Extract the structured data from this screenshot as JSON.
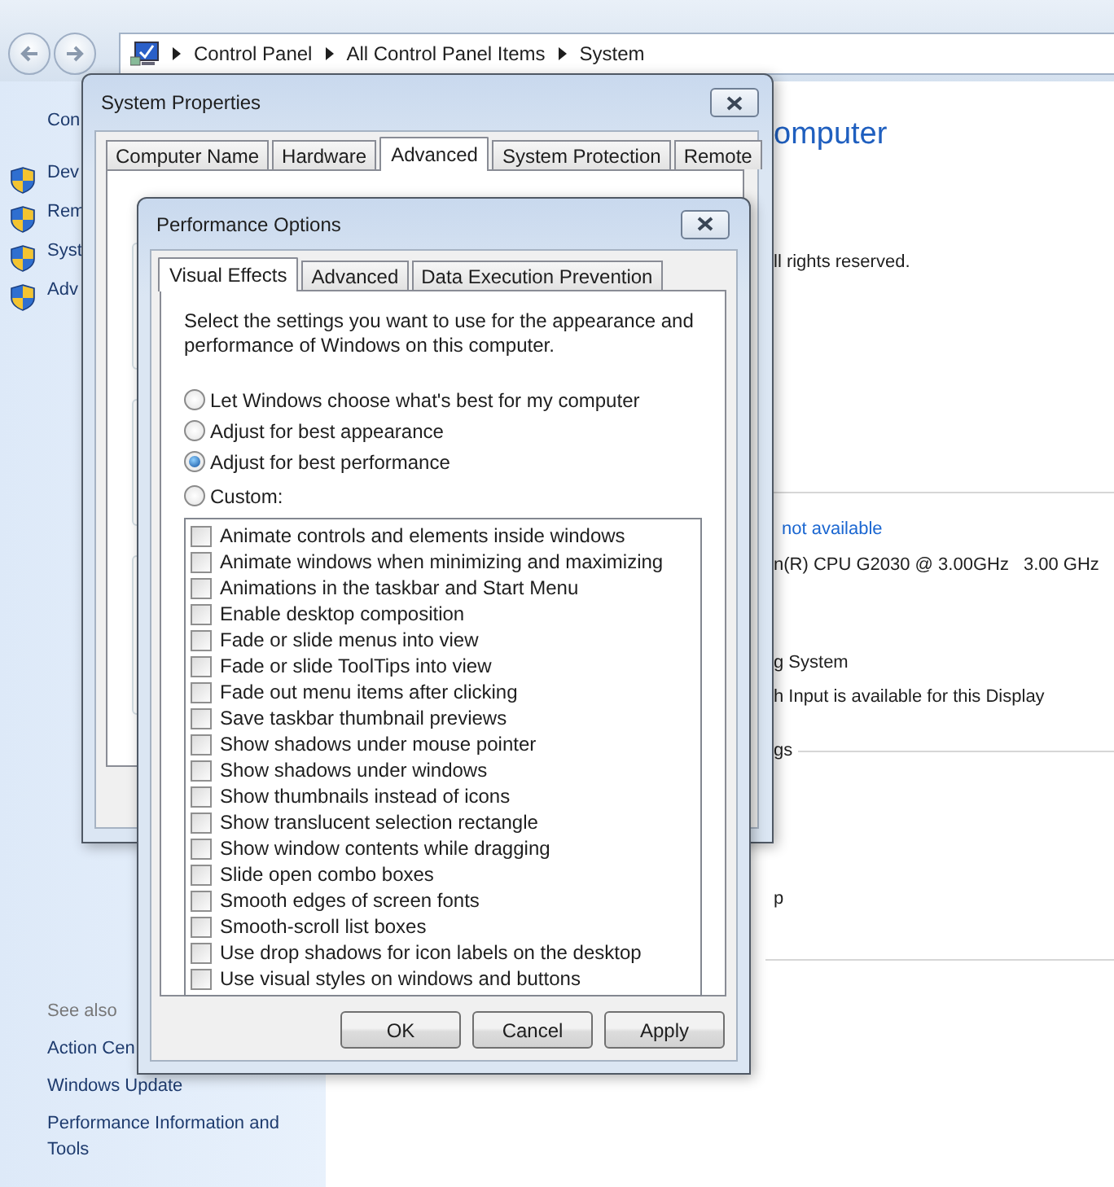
{
  "explorer": {
    "address_path": [
      "Control Panel",
      "All Control Panel Items",
      "System"
    ],
    "sidebar": {
      "home_link": "Con",
      "tasks": [
        "Dev",
        "Rem",
        "Syst",
        "Adv"
      ],
      "see_also_heading": "See also",
      "see_also": [
        "Action Cen",
        "Windows Update",
        "Performance Information and Tools"
      ]
    },
    "content": {
      "heading": "omputer",
      "copyright": "ll rights reserved.",
      "rating": "not available",
      "processor": {
        "name": "n(R) CPU G2030 @ 3.00GHz",
        "speed": "3.00 GHz"
      },
      "system_type": "g System",
      "pen_touch": "h Input is available for this Display",
      "section_label": "gs",
      "fragment": "p"
    }
  },
  "system_properties": {
    "title": "System Properties",
    "tabs": [
      {
        "label": "Computer Name",
        "selected": false
      },
      {
        "label": "Hardware",
        "selected": false
      },
      {
        "label": "Advanced",
        "selected": true
      },
      {
        "label": "System Protection",
        "selected": false
      },
      {
        "label": "Remote",
        "selected": false
      }
    ]
  },
  "performance_options": {
    "title": "Performance Options",
    "tabs": [
      {
        "label": "Visual Effects",
        "selected": true
      },
      {
        "label": "Advanced",
        "selected": false
      },
      {
        "label": "Data Execution Prevention",
        "selected": false
      }
    ],
    "description": "Select the settings you want to use for the appearance and performance of Windows on this computer.",
    "options": [
      {
        "label": "Let Windows choose what's best for my computer",
        "selected": false
      },
      {
        "label": "Adjust for best appearance",
        "selected": false
      },
      {
        "label": "Adjust for best performance",
        "selected": true
      },
      {
        "label": "Custom:",
        "selected": false
      }
    ],
    "effects": [
      {
        "label": "Animate controls and elements inside windows",
        "checked": false
      },
      {
        "label": "Animate windows when minimizing and maximizing",
        "checked": false
      },
      {
        "label": "Animations in the taskbar and Start Menu",
        "checked": false
      },
      {
        "label": "Enable desktop composition",
        "checked": false
      },
      {
        "label": "Fade or slide menus into view",
        "checked": false
      },
      {
        "label": "Fade or slide ToolTips into view",
        "checked": false
      },
      {
        "label": "Fade out menu items after clicking",
        "checked": false
      },
      {
        "label": "Save taskbar thumbnail previews",
        "checked": false
      },
      {
        "label": "Show shadows under mouse pointer",
        "checked": false
      },
      {
        "label": "Show shadows under windows",
        "checked": false
      },
      {
        "label": "Show thumbnails instead of icons",
        "checked": false
      },
      {
        "label": "Show translucent selection rectangle",
        "checked": false
      },
      {
        "label": "Show window contents while dragging",
        "checked": false
      },
      {
        "label": "Slide open combo boxes",
        "checked": false
      },
      {
        "label": "Smooth edges of screen fonts",
        "checked": false
      },
      {
        "label": "Smooth-scroll list boxes",
        "checked": false
      },
      {
        "label": "Use drop shadows for icon labels on the desktop",
        "checked": false
      },
      {
        "label": "Use visual styles on windows and buttons",
        "checked": false
      }
    ],
    "buttons": [
      "OK",
      "Cancel",
      "Apply"
    ]
  }
}
